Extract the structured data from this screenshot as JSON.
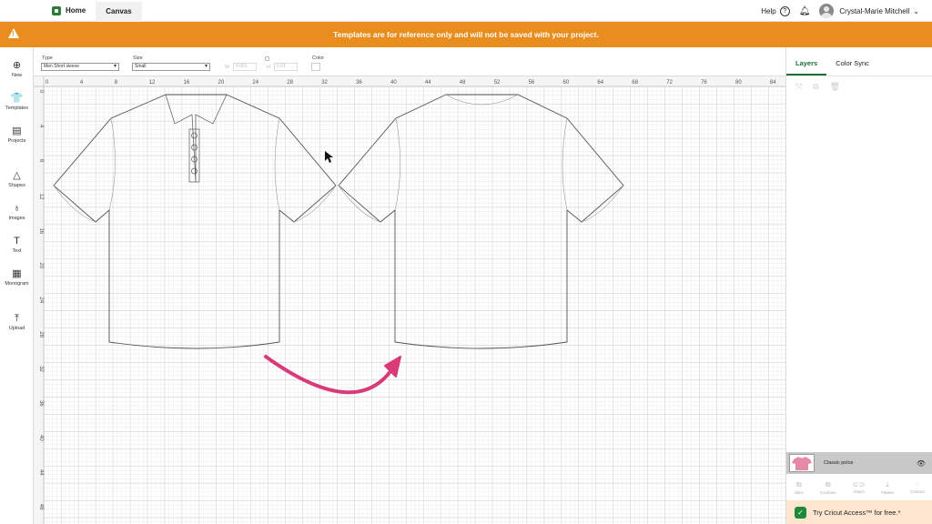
{
  "topbar": {
    "tabs": [
      {
        "label": "Home"
      },
      {
        "label": "Canvas"
      }
    ],
    "help_label": "Help",
    "help_icon": "?",
    "user_name": "Crystal-Marie Mitchell"
  },
  "banner": {
    "message": "Templates are for reference only and will not be saved with your project."
  },
  "sidebar": {
    "items": [
      {
        "label": "New",
        "icon": "⊕"
      },
      {
        "label": "Templates",
        "icon": "👕"
      },
      {
        "label": "Projects",
        "icon": "▤"
      },
      {
        "label": "Shapes",
        "icon": "△"
      },
      {
        "label": "Images",
        "icon": "♁"
      },
      {
        "label": "Text",
        "icon": "T"
      },
      {
        "label": "Monogram",
        "icon": "▦"
      },
      {
        "label": "Upload",
        "icon": "⤒"
      }
    ]
  },
  "properties": {
    "type_label": "Type",
    "type_value": "Men Short sleeve",
    "size_label": "Size",
    "size_value": "Small",
    "w_label": "W",
    "w_value": "0.001",
    "h_label": "H",
    "h_value": "0.01",
    "color_label": "Color"
  },
  "ruler": {
    "x_ticks": [
      "0",
      "4",
      "8",
      "12",
      "16",
      "20",
      "24",
      "28",
      "32",
      "36",
      "40",
      "44",
      "48",
      "52",
      "56",
      "60",
      "64",
      "68",
      "72",
      "76",
      "80",
      "84"
    ],
    "y_ticks": [
      "0",
      "4",
      "8",
      "12",
      "16",
      "20",
      "24",
      "28",
      "32",
      "36",
      "40",
      "44",
      "48"
    ]
  },
  "right_panel": {
    "tabs": [
      {
        "label": "Layers"
      },
      {
        "label": "Color Sync"
      }
    ],
    "layer_name": "Classic polos",
    "bottom_tools": [
      {
        "label": "Slice",
        "icon": "⧉"
      },
      {
        "label": "Combine",
        "icon": "⧉"
      },
      {
        "label": "Attach",
        "icon": "⊂⊃"
      },
      {
        "label": "Flatten",
        "icon": "⤓"
      },
      {
        "label": "Contour",
        "icon": "◌"
      }
    ],
    "access_text": "Try Cricut Access™ for free.*"
  },
  "colors": {
    "banner": "#e98d1f",
    "accent_green": "#1f6e36",
    "arrow": "#d93a78",
    "grid_minor": "#e3e3e3",
    "grid_major": "#bdbdbd"
  }
}
